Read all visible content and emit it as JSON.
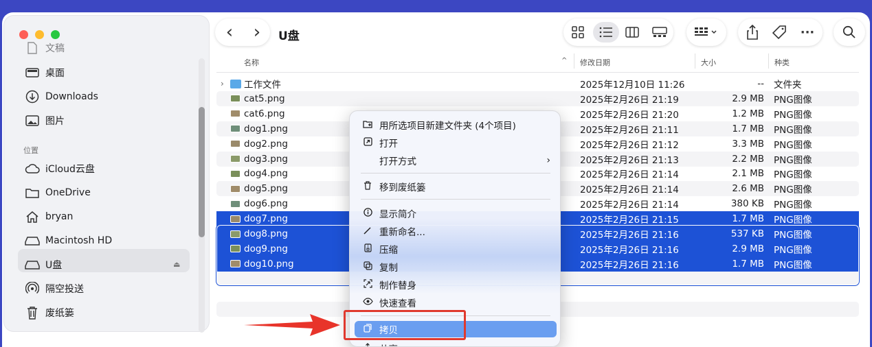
{
  "window": {
    "title": "U盘"
  },
  "sidebar": {
    "top_items": [
      {
        "label": "文稿",
        "icon": "document-icon"
      },
      {
        "label": "桌面",
        "icon": "desktop-icon"
      },
      {
        "label": "Downloads",
        "icon": "download-icon"
      },
      {
        "label": "图片",
        "icon": "photo-icon"
      }
    ],
    "section_locations": "位置",
    "location_items": [
      {
        "label": "iCloud云盘",
        "icon": "cloud-icon"
      },
      {
        "label": "OneDrive",
        "icon": "folder-icon"
      },
      {
        "label": "bryan",
        "icon": "home-icon"
      },
      {
        "label": "Macintosh HD",
        "icon": "drive-icon"
      },
      {
        "label": "U盘",
        "icon": "drive-icon"
      },
      {
        "label": "隔空投送",
        "icon": "airdrop-icon"
      },
      {
        "label": "废纸篓",
        "icon": "trash-icon"
      }
    ],
    "eject": "⏏"
  },
  "toolbar": {
    "back": "‹",
    "forward": "›",
    "more": "···"
  },
  "columns": {
    "name": "名称",
    "date": "修改日期",
    "size": "大小",
    "kind": "种类"
  },
  "files": [
    {
      "name": "工作文件",
      "date": "2025年12月10日 11:26",
      "size": "--",
      "kind": "文件夹"
    },
    {
      "name": "cat5.png",
      "date": "2025年2月26日 21:19",
      "size": "2.9 MB",
      "kind": "PNG图像"
    },
    {
      "name": "cat6.png",
      "date": "2025年2月26日 21:20",
      "size": "1.2 MB",
      "kind": "PNG图像"
    },
    {
      "name": "dog1.png",
      "date": "2025年2月26日 21:11",
      "size": "1.7 MB",
      "kind": "PNG图像"
    },
    {
      "name": "dog2.png",
      "date": "2025年2月26日 21:12",
      "size": "3.3 MB",
      "kind": "PNG图像"
    },
    {
      "name": "dog3.png",
      "date": "2025年2月26日 21:13",
      "size": "2.2 MB",
      "kind": "PNG图像"
    },
    {
      "name": "dog4.png",
      "date": "2025年2月26日 21:14",
      "size": "2.1 MB",
      "kind": "PNG图像"
    },
    {
      "name": "dog5.png",
      "date": "2025年2月26日 21:14",
      "size": "2.6 MB",
      "kind": "PNG图像"
    },
    {
      "name": "dog6.png",
      "date": "2025年2月26日 21:14",
      "size": "380 KB",
      "kind": "PNG图像"
    },
    {
      "name": "dog7.png",
      "date": "2025年2月26日 21:15",
      "size": "1.7 MB",
      "kind": "PNG图像"
    },
    {
      "name": "dog8.png",
      "date": "2025年2月26日 21:16",
      "size": "537 KB",
      "kind": "PNG图像"
    },
    {
      "name": "dog9.png",
      "date": "2025年2月26日 21:16",
      "size": "2.9 MB",
      "kind": "PNG图像"
    },
    {
      "name": "dog10.png",
      "date": "2025年2月26日 21:16",
      "size": "1.7 MB",
      "kind": "PNG图像"
    }
  ],
  "context_menu": {
    "new_folder": "用所选项目新建文件夹 (4个项目)",
    "open": "打开",
    "open_with": "打开方式",
    "trash": "移到废纸篓",
    "get_info": "显示简介",
    "rename": "重新命名...",
    "compress": "压缩",
    "duplicate": "复制",
    "make_alias": "制作替身",
    "quick_look": "快速查看",
    "copy": "拷贝",
    "share": "共享..."
  },
  "colors": {
    "selection": "#1d52d6",
    "highlight": "#6a9ef0",
    "annotation": "#e0392e"
  }
}
